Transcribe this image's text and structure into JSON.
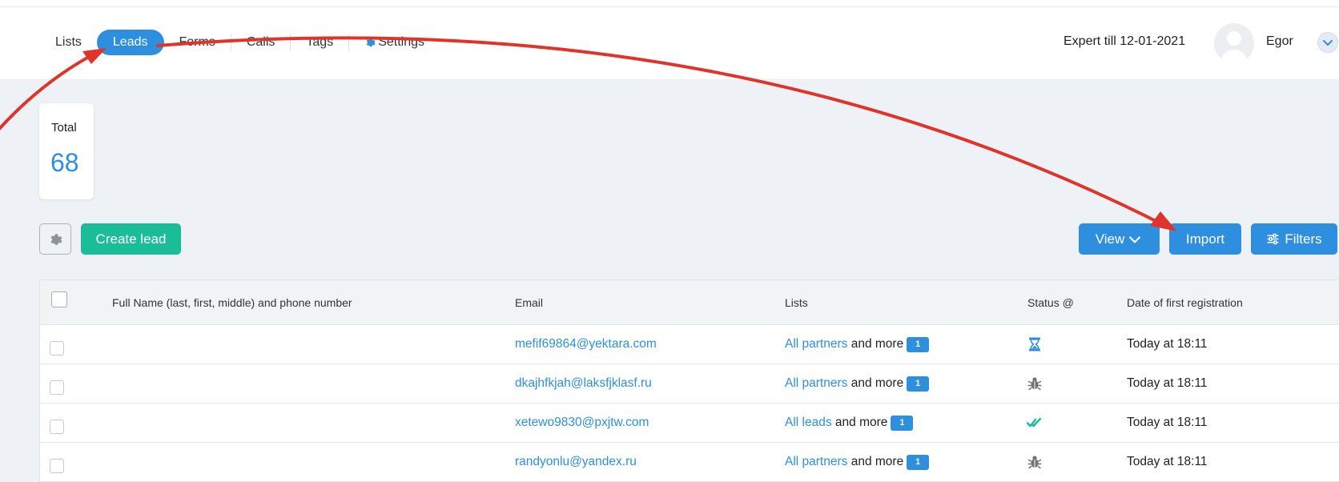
{
  "nav": {
    "items": [
      {
        "label": "Lists",
        "active": false
      },
      {
        "label": "Leads",
        "active": true
      },
      {
        "label": "Forms",
        "active": false
      },
      {
        "label": "Calls",
        "active": false
      },
      {
        "label": "Tags",
        "active": false
      },
      {
        "label": "Settings",
        "active": false,
        "icon": "gear-icon"
      }
    ]
  },
  "header": {
    "plan": "Expert till 12-01-2021",
    "user_name": "Egor",
    "avatar_icon": "avatar-icon",
    "menu_icon": "chevron-down-icon"
  },
  "stats": {
    "total_label": "Total",
    "total_value": "68"
  },
  "toolbar": {
    "settings_icon": "gear-icon",
    "create_label": "Create lead",
    "view_label": "View",
    "import_label": "Import",
    "filters_label": "Filters"
  },
  "table": {
    "columns": [
      "Full Name (last, first, middle) and phone number",
      "Email",
      "Lists",
      "Status @",
      "Date of first registration"
    ],
    "rows": [
      {
        "name": "",
        "email": "mefif69864@yektara.com",
        "list": "All partners",
        "more_text": "and more",
        "more_count": "1",
        "status_icon": "hourglass-icon",
        "date": "Today at 18:11"
      },
      {
        "name": "",
        "email": "dkajhfkjah@laksfjklasf.ru",
        "list": "All partners",
        "more_text": "and more",
        "more_count": "1",
        "status_icon": "bug-icon",
        "date": "Today at 18:11"
      },
      {
        "name": "",
        "email": "xetewo9830@pxjtw.com",
        "list": "All leads",
        "more_text": "and more",
        "more_count": "1",
        "status_icon": "double-check-icon",
        "date": "Today at 18:11"
      },
      {
        "name": "",
        "email": "randyonlu@yandex.ru",
        "list": "All partners",
        "more_text": "and more",
        "more_count": "1",
        "status_icon": "bug-icon",
        "date": "Today at 18:11"
      }
    ]
  },
  "colors": {
    "accent_blue": "#2f8fdf",
    "accent_green": "#1bbd98",
    "annotation_red": "#e0342a"
  }
}
